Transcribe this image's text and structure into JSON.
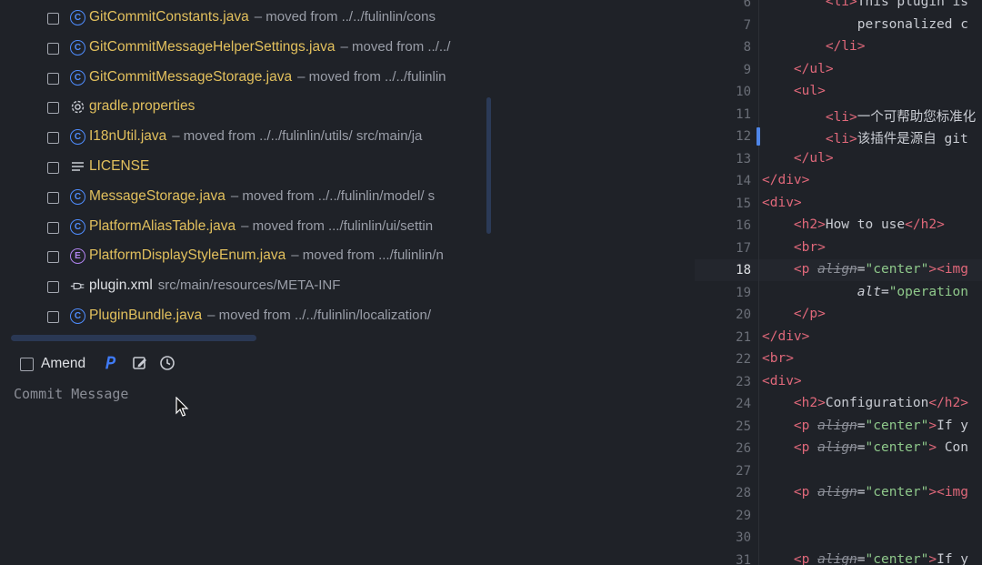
{
  "files": [
    {
      "icon": "class-icon",
      "name": "GitCommitConstants.java",
      "hint": "moved from ../../fulinlin/cons",
      "plain": false
    },
    {
      "icon": "class-icon",
      "name": "GitCommitMessageHelperSettings.java",
      "hint": "moved from ../../",
      "plain": false
    },
    {
      "icon": "class-icon",
      "name": "GitCommitMessageStorage.java",
      "hint": "moved from ../../fulinlin",
      "plain": false
    },
    {
      "icon": "gear-icon",
      "name": "gradle.properties",
      "hint": "",
      "plain": false
    },
    {
      "icon": "class-icon",
      "name": "I18nUtil.java",
      "hint": "moved from ../../fulinlin/utils/  src/main/ja",
      "plain": false
    },
    {
      "icon": "text-file-icon",
      "name": "LICENSE",
      "hint": "",
      "plain": false
    },
    {
      "icon": "class-icon",
      "name": "MessageStorage.java",
      "hint": "moved from ../../fulinlin/model/  s",
      "plain": false
    },
    {
      "icon": "class-icon",
      "name": "PlatformAliasTable.java",
      "hint": "moved from .../fulinlin/ui/settin",
      "plain": false
    },
    {
      "icon": "enum-icon",
      "name": "PlatformDisplayStyleEnum.java",
      "hint": "moved from .../fulinlin/n",
      "plain": false
    },
    {
      "icon": "plugin-icon",
      "name": "plugin.xml",
      "hint": "src/main/resources/META-INF",
      "plain": true
    },
    {
      "icon": "class-icon",
      "name": "PluginBundle.java",
      "hint": "moved from ../../fulinlin/localization/",
      "plain": false
    }
  ],
  "amend_label": "Amend",
  "commit_message_placeholder": "Commit Message",
  "editor": {
    "active_line": "18",
    "lines": [
      {
        "n": "6",
        "html": "        <span class=\"tag\">&lt;li&gt;</span>This plugin is"
      },
      {
        "n": "7",
        "html": "            personalized c"
      },
      {
        "n": "8",
        "html": "        <span class=\"tag\">&lt;/li&gt;</span>"
      },
      {
        "n": "9",
        "html": "    <span class=\"tag\">&lt;/ul&gt;</span>"
      },
      {
        "n": "10",
        "html": "    <span class=\"tag\">&lt;ul&gt;</span>"
      },
      {
        "n": "11",
        "html": "        <span class=\"tag\">&lt;li&gt;</span>一个可帮助您标准化"
      },
      {
        "n": "12",
        "html": "        <span class=\"tag\">&lt;li&gt;</span>该插件是源自 git"
      },
      {
        "n": "13",
        "html": "    <span class=\"tag\">&lt;/ul&gt;</span>"
      },
      {
        "n": "14",
        "html": "<span class=\"tag\">&lt;/div&gt;</span>"
      },
      {
        "n": "15",
        "html": "<span class=\"tag\">&lt;div&gt;</span>"
      },
      {
        "n": "16",
        "html": "    <span class=\"tag\">&lt;h2&gt;</span>How to use<span class=\"tag\">&lt;/h2&gt;</span>"
      },
      {
        "n": "17",
        "html": "    <span class=\"tag\">&lt;br&gt;</span>"
      },
      {
        "n": "18",
        "html": "    <span class=\"tag\">&lt;p</span> <span class=\"attr-dep\">align</span>=<span class=\"str\">\"center\"</span><span class=\"tag\">&gt;&lt;img</span>"
      },
      {
        "n": "19",
        "html": "            <span class=\"attr\">alt</span>=<span class=\"str\">\"operation</span>"
      },
      {
        "n": "20",
        "html": "    <span class=\"tag\">&lt;/p&gt;</span>"
      },
      {
        "n": "21",
        "html": "<span class=\"tag\">&lt;/div&gt;</span>"
      },
      {
        "n": "22",
        "html": "<span class=\"tag\">&lt;br&gt;</span>"
      },
      {
        "n": "23",
        "html": "<span class=\"tag\">&lt;div&gt;</span>"
      },
      {
        "n": "24",
        "html": "    <span class=\"tag\">&lt;h2&gt;</span>Configuration<span class=\"tag\">&lt;/h2&gt;</span>"
      },
      {
        "n": "25",
        "html": "    <span class=\"tag\">&lt;p</span> <span class=\"attr-dep\">align</span>=<span class=\"str\">\"center\"</span><span class=\"tag\">&gt;</span>If y"
      },
      {
        "n": "26",
        "html": "    <span class=\"tag\">&lt;p</span> <span class=\"attr-dep\">align</span>=<span class=\"str\">\"center\"</span><span class=\"tag\">&gt;</span> Con"
      },
      {
        "n": "27",
        "html": ""
      },
      {
        "n": "28",
        "html": "    <span class=\"tag\">&lt;p</span> <span class=\"attr-dep\">align</span>=<span class=\"str\">\"center\"</span><span class=\"tag\">&gt;&lt;img</span>"
      },
      {
        "n": "29",
        "html": ""
      },
      {
        "n": "30",
        "html": ""
      },
      {
        "n": "31",
        "html": "    <span class=\"tag\">&lt;p</span> <span class=\"attr-dep\">align</span>=<span class=\"str\">\"center\"</span><span class=\"tag\">&gt;</span>If y"
      }
    ]
  }
}
